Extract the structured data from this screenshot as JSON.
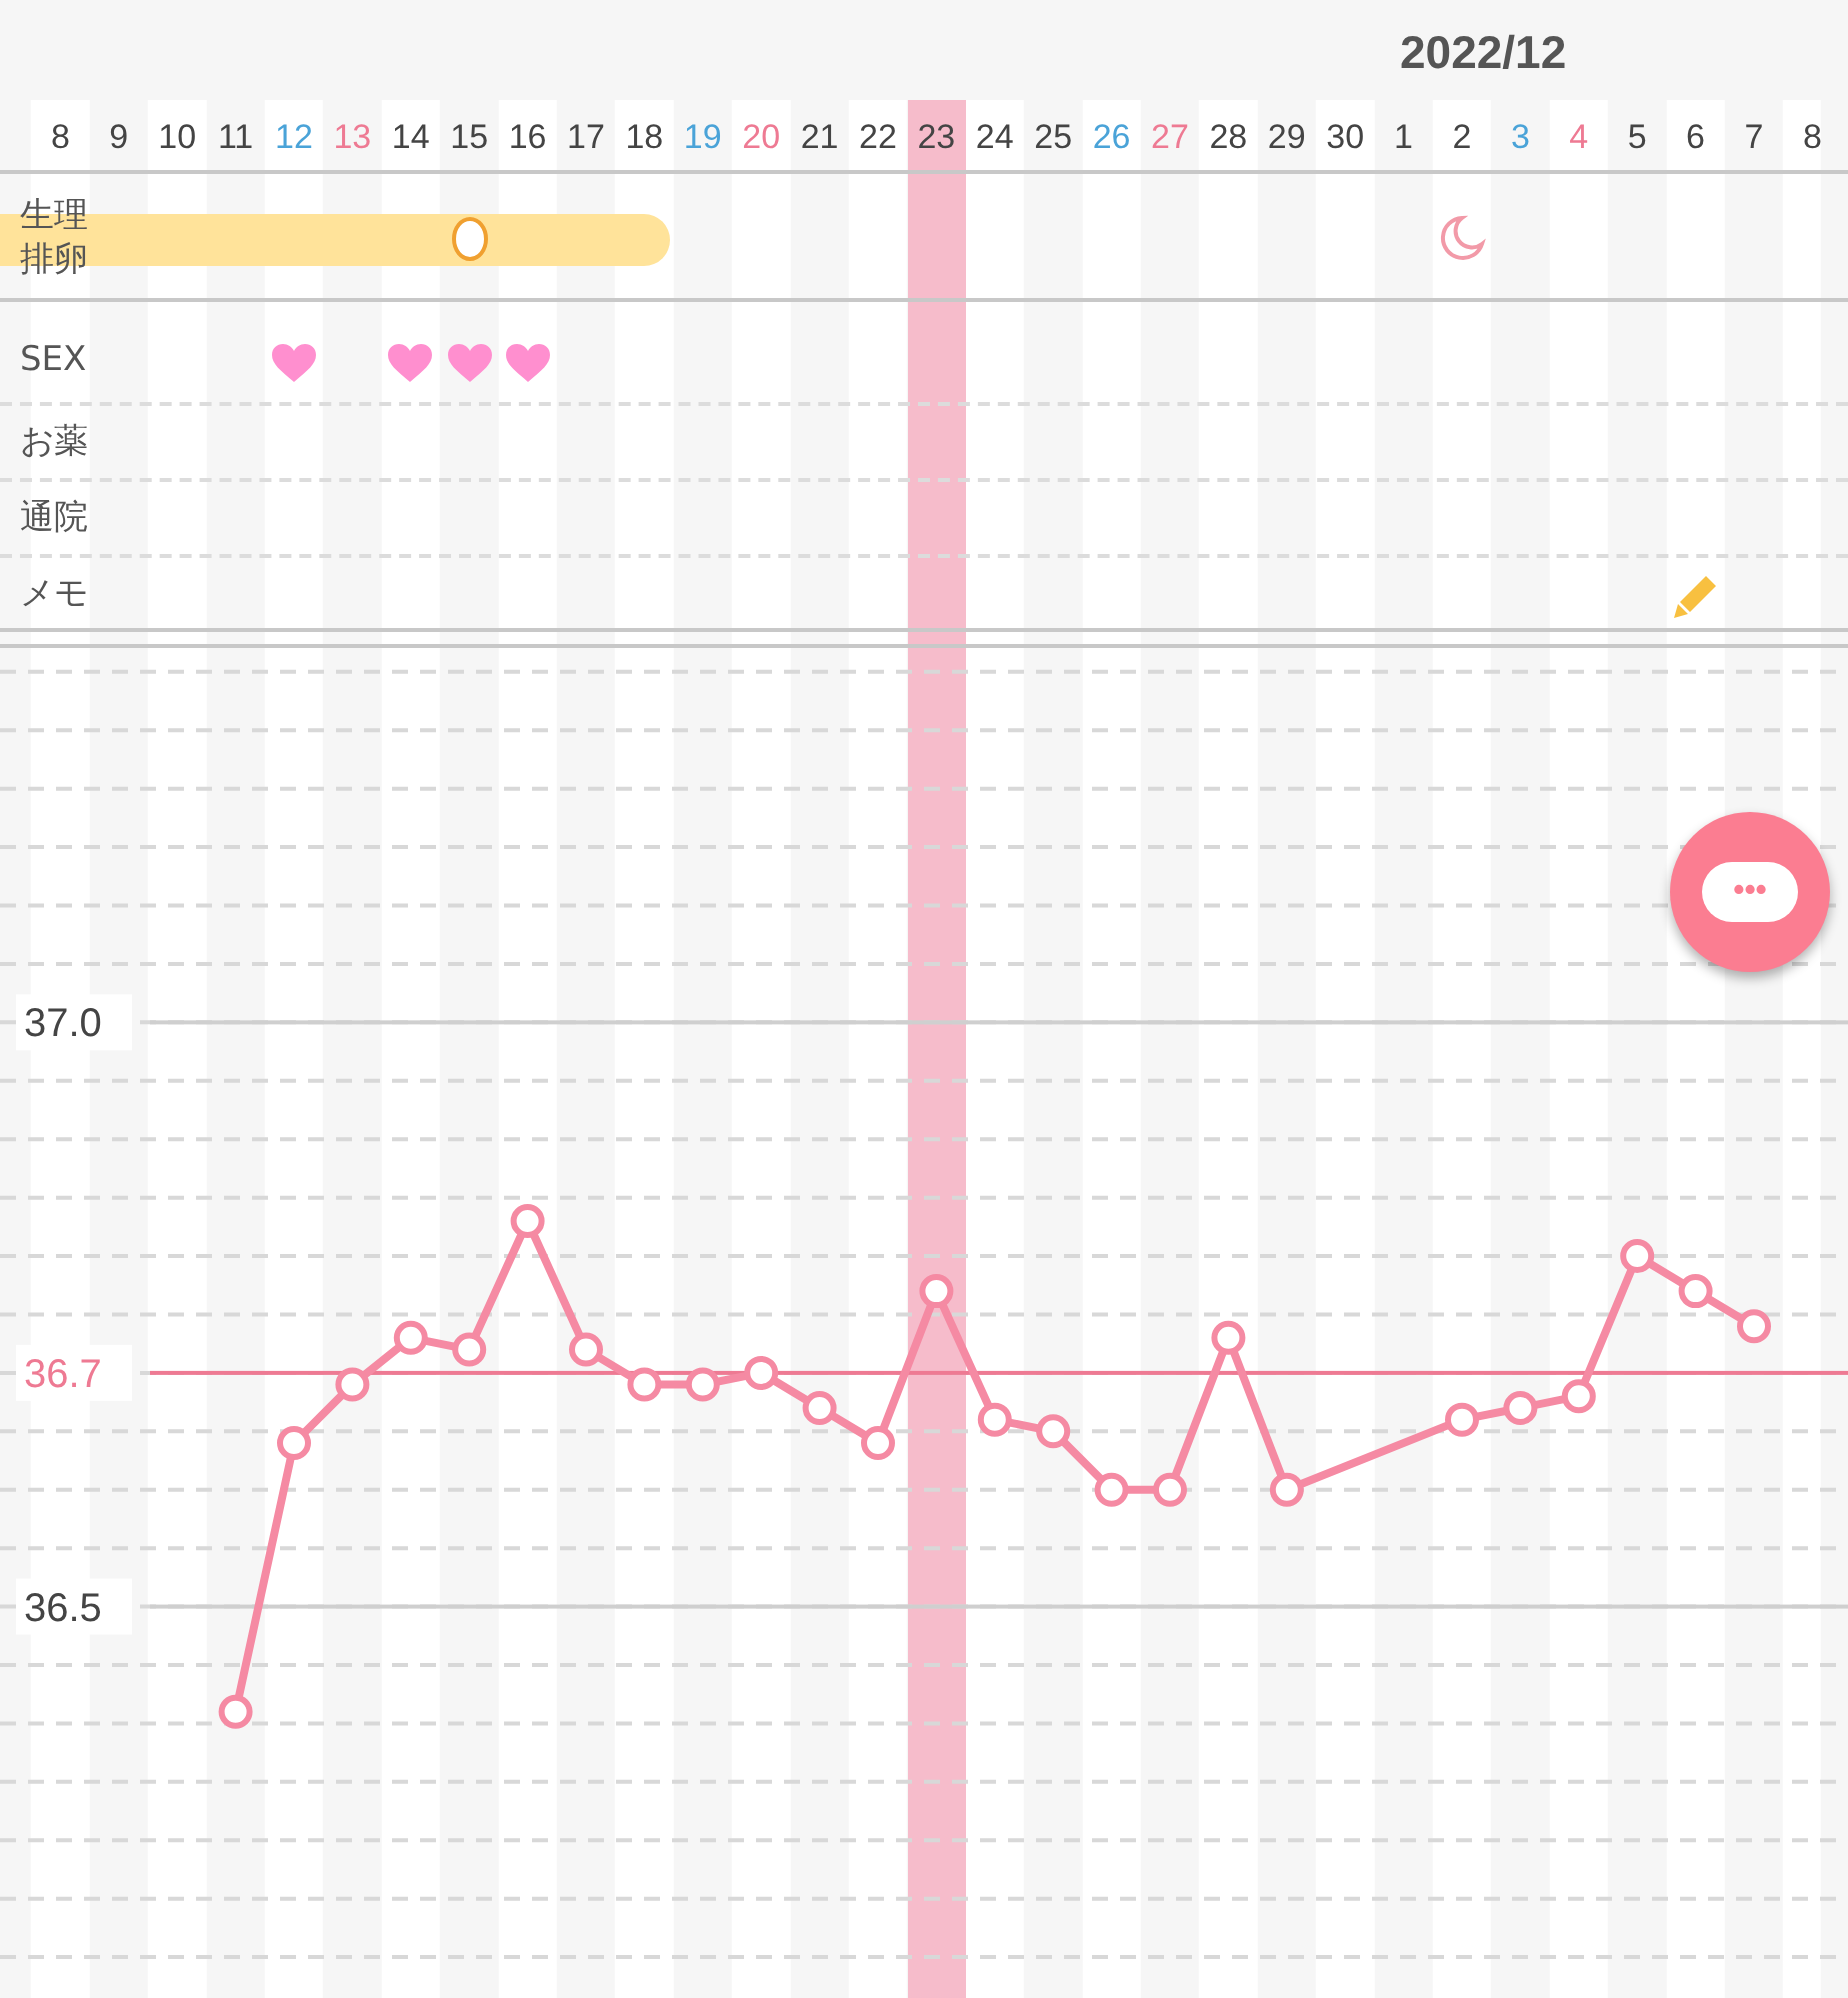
{
  "header": {
    "month": "2022/12"
  },
  "rows": [
    {
      "kind": "cycle",
      "labels": [
        "生理",
        "排卵"
      ],
      "cells": [
        {
          "kind": "period"
        },
        {
          "kind": "period"
        },
        {
          "kind": "period"
        },
        {
          "kind": "period"
        },
        {
          "kind": "period"
        },
        {
          "kind": "period"
        },
        {
          "kind": "period"
        },
        {
          "kind": "ovulation"
        },
        {
          "kind": "period"
        },
        {
          "kind": "period"
        },
        {
          "kind": "period"
        },
        {
          "kind": "none"
        },
        {
          "kind": "none"
        },
        {
          "kind": "none"
        },
        {
          "kind": "none"
        },
        {
          "kind": "none"
        },
        {
          "kind": "none"
        },
        {
          "kind": "none"
        },
        {
          "kind": "none"
        },
        {
          "kind": "none"
        },
        {
          "kind": "none"
        },
        {
          "kind": "none"
        },
        {
          "kind": "none"
        },
        {
          "kind": "none"
        },
        {
          "kind": "moon"
        }
      ]
    },
    {
      "kind": "sex",
      "labels": [
        "SEX"
      ],
      "cells": [
        {
          "kind": "none"
        },
        {
          "kind": "none"
        },
        {
          "kind": "none"
        },
        {
          "kind": "none"
        },
        {
          "kind": "heart"
        },
        {
          "kind": "none"
        },
        {
          "kind": "heart"
        },
        {
          "kind": "heart"
        },
        {
          "kind": "heart"
        }
      ]
    },
    {
      "kind": "medicine",
      "labels": [
        "お薬"
      ]
    },
    {
      "kind": "clinic",
      "labels": [
        "通院"
      ]
    },
    {
      "kind": "memo",
      "labels": [
        "メモ"
      ],
      "cells": [
        {
          "kind": "none"
        },
        {
          "kind": "none"
        },
        {
          "kind": "none"
        },
        {
          "kind": "none"
        },
        {
          "kind": "none"
        },
        {
          "kind": "none"
        },
        {
          "kind": "none"
        },
        {
          "kind": "none"
        },
        {
          "kind": "none"
        },
        {
          "kind": "none"
        },
        {
          "kind": "none"
        },
        {
          "kind": "none"
        },
        {
          "kind": "none"
        },
        {
          "kind": "none"
        },
        {
          "kind": "none"
        },
        {
          "kind": "none"
        },
        {
          "kind": "none"
        },
        {
          "kind": "none"
        },
        {
          "kind": "none"
        },
        {
          "kind": "none"
        },
        {
          "kind": "none"
        },
        {
          "kind": "none"
        },
        {
          "kind": "none"
        },
        {
          "kind": "none"
        },
        {
          "kind": "none"
        },
        {
          "kind": "none"
        },
        {
          "kind": "none"
        },
        {
          "kind": "none"
        },
        {
          "kind": "pencil"
        }
      ]
    }
  ],
  "days": [
    {
      "label": "8",
      "kind": "weekday",
      "selected": false
    },
    {
      "label": "9",
      "kind": "weekday",
      "selected": false
    },
    {
      "label": "10",
      "kind": "weekday",
      "selected": false
    },
    {
      "label": "11",
      "kind": "weekday",
      "selected": false
    },
    {
      "label": "12",
      "kind": "saturday",
      "selected": false
    },
    {
      "label": "13",
      "kind": "sunday",
      "selected": false
    },
    {
      "label": "14",
      "kind": "weekday",
      "selected": false
    },
    {
      "label": "15",
      "kind": "weekday",
      "selected": false
    },
    {
      "label": "16",
      "kind": "weekday",
      "selected": false
    },
    {
      "label": "17",
      "kind": "weekday",
      "selected": false
    },
    {
      "label": "18",
      "kind": "weekday",
      "selected": false
    },
    {
      "label": "19",
      "kind": "saturday",
      "selected": false
    },
    {
      "label": "20",
      "kind": "sunday",
      "selected": false
    },
    {
      "label": "21",
      "kind": "weekday",
      "selected": false
    },
    {
      "label": "22",
      "kind": "weekday",
      "selected": false
    },
    {
      "label": "23",
      "kind": "weekday",
      "selected": true
    },
    {
      "label": "24",
      "kind": "weekday",
      "selected": false
    },
    {
      "label": "25",
      "kind": "weekday",
      "selected": false
    },
    {
      "label": "26",
      "kind": "saturday",
      "selected": false
    },
    {
      "label": "27",
      "kind": "sunday",
      "selected": false
    },
    {
      "label": "28",
      "kind": "weekday",
      "selected": false
    },
    {
      "label": "29",
      "kind": "weekday",
      "selected": false
    },
    {
      "label": "30",
      "kind": "weekday",
      "selected": false
    },
    {
      "label": "1",
      "kind": "weekday",
      "selected": false
    },
    {
      "label": "2",
      "kind": "weekday",
      "selected": false
    },
    {
      "label": "3",
      "kind": "saturday",
      "selected": false
    },
    {
      "label": "4",
      "kind": "sunday",
      "selected": false
    },
    {
      "label": "5",
      "kind": "weekday",
      "selected": false
    },
    {
      "label": "6",
      "kind": "weekday",
      "selected": false
    },
    {
      "label": "7",
      "kind": "weekday",
      "selected": false
    },
    {
      "label": "8",
      "kind": "weekday",
      "selected": false
    }
  ],
  "temperature": {
    "chart_data": {
      "type": "line",
      "series": [
        {
          "color": "#f58aa3",
          "marker": "o",
          "values": [
            null,
            null,
            null,
            36.41,
            36.64,
            36.69,
            36.73,
            36.72,
            36.83,
            36.72,
            36.69,
            36.69,
            36.7,
            36.67,
            36.64,
            36.77,
            36.66,
            36.65,
            36.6,
            36.6,
            36.73,
            36.6,
            null,
            null,
            36.66,
            36.67,
            36.68,
            36.8,
            36.77,
            36.74,
            null
          ]
        }
      ],
      "ylim": [
        36.165,
        37.875
      ],
      "yticks": [
        {
          "value": 36.5,
          "label": "36.5"
        },
        {
          "value": 37.0,
          "label": "37.0"
        }
      ],
      "ref_lines": [
        {
          "axis": "y",
          "value": 37.0,
          "color": "#cfcfcf"
        },
        {
          "axis": "y",
          "value": 36.5,
          "color": "#cfcfcf"
        },
        {
          "axis": "y",
          "value": 36.7,
          "label": "36.7",
          "color": "#ee7a93"
        }
      ]
    }
  },
  "chat_button": {
    "label": "•••"
  }
}
